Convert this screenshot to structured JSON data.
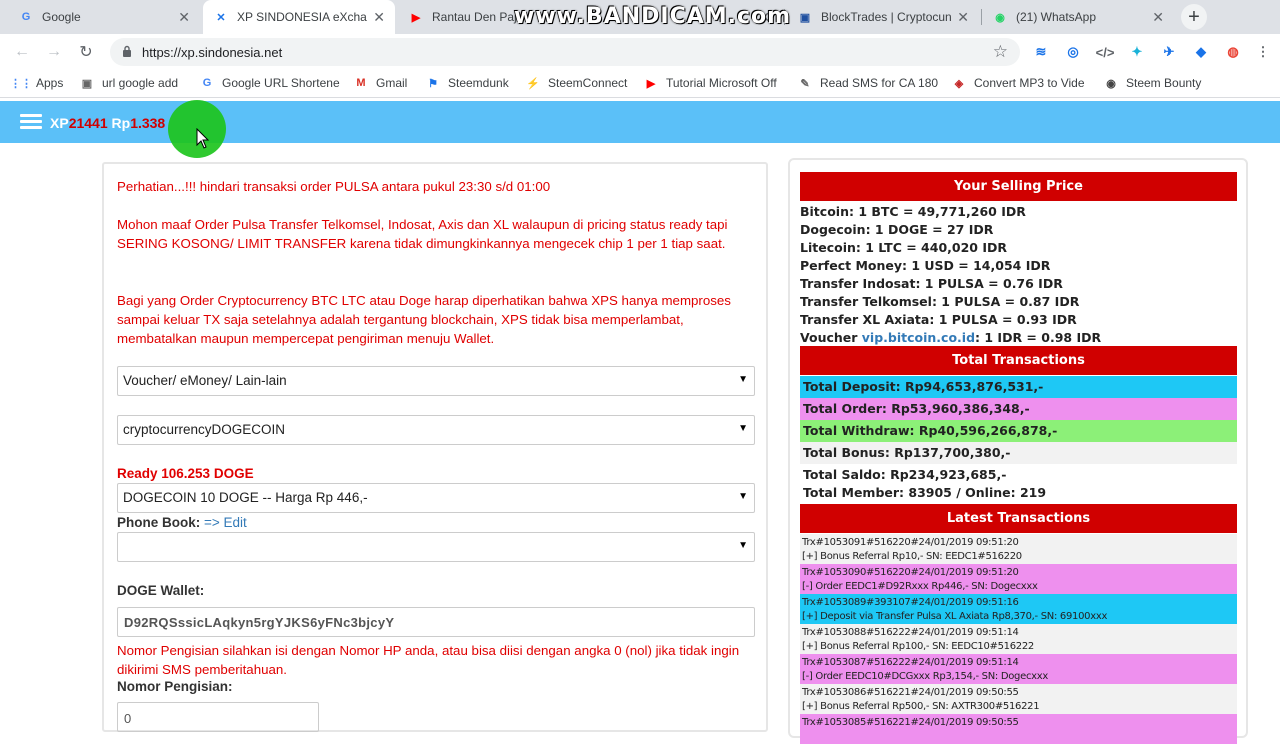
{
  "browser": {
    "tabs": [
      {
        "title": "Google",
        "icon": "google-icon"
      },
      {
        "title": "XP SINDONESIA eXchan",
        "icon": "xp-icon"
      },
      {
        "title": "Rantau Den Paja",
        "icon": "youtube-icon"
      },
      {
        "title": "BlockTrades | Cryptocun",
        "icon": "blocktrades-icon"
      },
      {
        "title": "(21) WhatsApp",
        "icon": "whatsapp-icon"
      }
    ],
    "watermark": "www.BANDICAM.com",
    "url": "https://xp.sindonesia.net",
    "bookmarks": [
      "Apps",
      "url google add",
      "Google URL Shortene",
      "Gmail",
      "Steemdunk",
      "SteemConnect",
      "Tutorial Microsoft Off",
      "Read SMS for CA 180",
      "Convert MP3 to Vide",
      "Steem Bounty"
    ]
  },
  "header": {
    "xp_label": "XP",
    "xp_value": "21441",
    "rp_label": "Rp",
    "rp_value": "1.338"
  },
  "left": {
    "notice1": "Perhatian...!!! hindari transaksi order PULSA antara pukul 23:30 s/d 01:00",
    "notice2": "Mohon maaf Order Pulsa Transfer Telkomsel, Indosat, Axis dan XL walaupun di pricing status ready tapi SERING KOSONG/ LIMIT TRANSFER karena tidak dimungkinkannya mengecek chip 1 per 1 tiap saat.",
    "notice3": "Bagi yang Order Cryptocurrency BTC LTC atau Doge harap diperhatikan bahwa XPS hanya memproses sampai keluar TX saja setelahnya adalah tergantung blockchain, XPS tidak bisa memperlambat, membatalkan maupun mempercepat pengiriman menuju Wallet.",
    "select_category": "Voucher/ eMoney/ Lain-lain",
    "select_product": "cryptocurrencyDOGECOIN",
    "ready_label": "Ready 106.253 DOGE",
    "select_package": "DOGECOIN 10 DOGE -- Harga Rp 446,-",
    "phonebook_label": "Phone Book:",
    "phonebook_edit": "=> Edit",
    "select_phonebook": "",
    "wallet_label": "DOGE Wallet:",
    "wallet_value": "D92RQSssicLAqkyn5rgYJKS6yFNc3bjcyY",
    "hint": "Nomor Pengisian silahkan isi dengan Nomor HP anda, atau bisa diisi dengan angka 0 (nol) jika tidak ingin dikirimi SMS pemberitahuan.",
    "nomor_label": "Nomor Pengisian:",
    "nomor_value": "0"
  },
  "right": {
    "selling_title": "Your Selling Price",
    "prices": [
      "Bitcoin: 1 BTC = 49,771,260 IDR",
      "Dogecoin: 1 DOGE = 27 IDR",
      "Litecoin: 1 LTC = 440,020 IDR",
      "Perfect Money: 1 USD = 14,054 IDR",
      "Transfer Indosat: 1 PULSA = 0.76 IDR",
      "Transfer Telkomsel: 1 PULSA = 0.87 IDR",
      "Transfer XL Axiata: 1 PULSA = 0.93 IDR"
    ],
    "voucher_prefix": "Voucher ",
    "voucher_link": "vip.bitcoin.co.id",
    "voucher_suffix": ": 1 IDR = 0.98 IDR",
    "totals_title": "Total Transactions",
    "totals": [
      {
        "text": "Total Deposit: Rp94,653,876,531,-",
        "color": "#1ec8f5"
      },
      {
        "text": "Total Order: Rp53,960,386,348,-",
        "color": "#ee90ee"
      },
      {
        "text": "Total Withdraw: Rp40,596,266,878,-",
        "color": "#8cf078"
      },
      {
        "text": "Total Bonus: Rp137,700,380,-",
        "color": "#f2f2f2"
      },
      {
        "text": "Total Saldo: Rp234,923,685,-",
        "color": "#ffffff"
      },
      {
        "text": "Total Member: 83905 / Online: 219",
        "color": "#ffffff"
      }
    ],
    "latest_title": "Latest Transactions",
    "latest": [
      {
        "l1": "Trx#1053091#516220#24/01/2019 09:51:20",
        "l2": "[+] Bonus Referral Rp10,- SN: EEDC1#516220",
        "color": "#f2f2f2"
      },
      {
        "l1": "Trx#1053090#516220#24/01/2019 09:51:20",
        "l2": "[-] Order EEDC1#D92Rxxx Rp446,- SN: Dogecxxx",
        "color": "#ee90ee"
      },
      {
        "l1": "Trx#1053089#393107#24/01/2019 09:51:16",
        "l2": "[+] Deposit via Transfer Pulsa XL Axiata Rp8,370,- SN: 69100xxx",
        "color": "#1ec8f5"
      },
      {
        "l1": "Trx#1053088#516222#24/01/2019 09:51:14",
        "l2": "[+] Bonus Referral Rp100,- SN: EEDC10#516222",
        "color": "#f2f2f2"
      },
      {
        "l1": "Trx#1053087#516222#24/01/2019 09:51:14",
        "l2": "[-] Order EEDC10#DCGxxx Rp3,154,- SN: Dogecxxx",
        "color": "#ee90ee"
      },
      {
        "l1": "Trx#1053086#516221#24/01/2019 09:50:55",
        "l2": "[+] Bonus Referral Rp500,- SN: AXTR300#516221",
        "color": "#f2f2f2"
      },
      {
        "l1": "Trx#1053085#516221#24/01/2019 09:50:55",
        "l2": "",
        "color": "#ee90ee"
      }
    ]
  }
}
